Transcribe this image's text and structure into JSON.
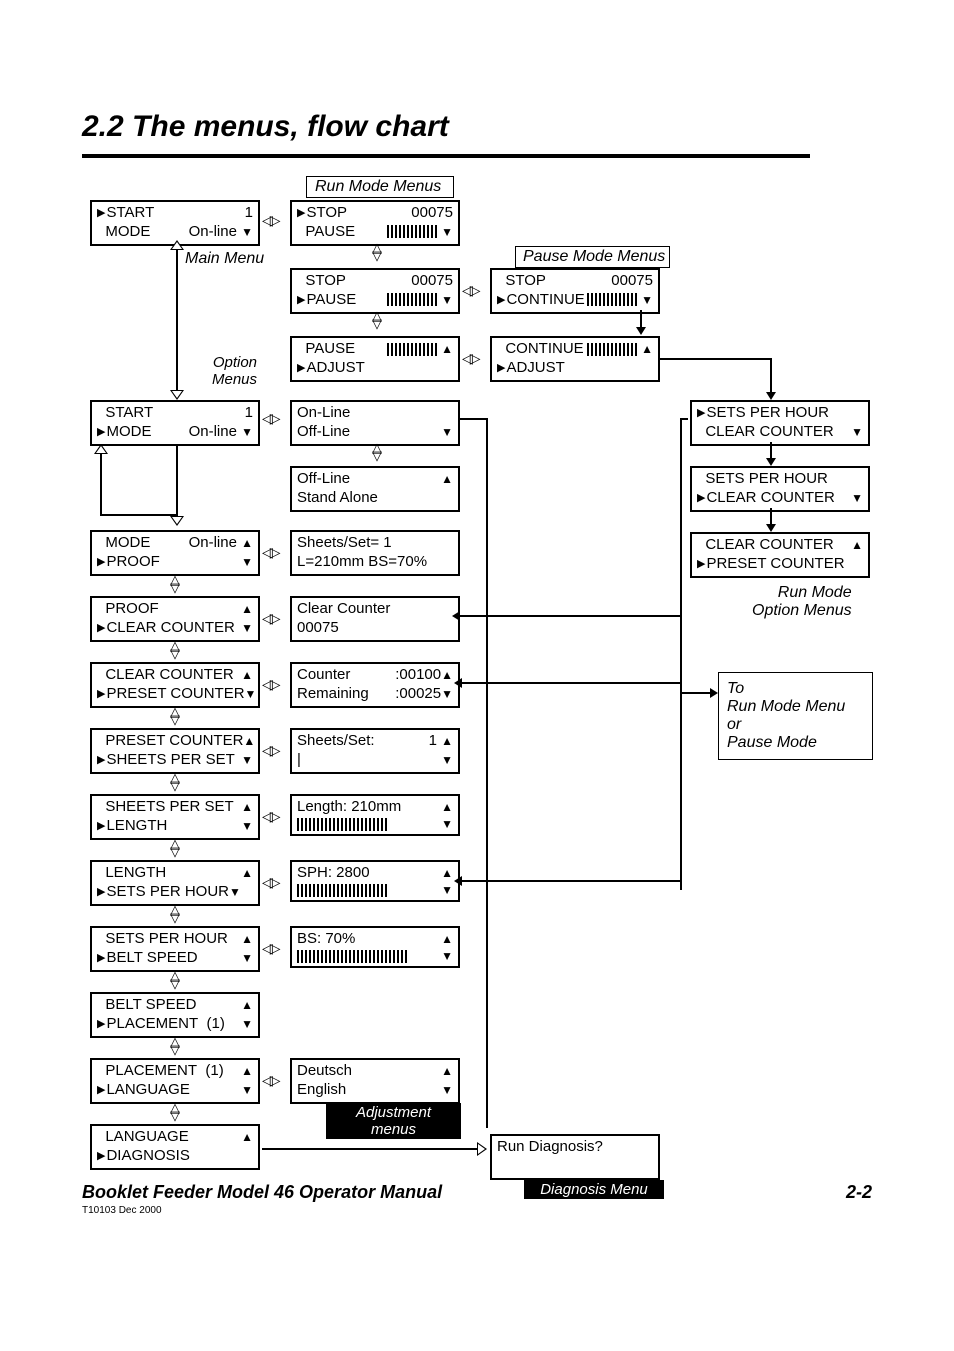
{
  "title": "2.2 The menus, flow chart",
  "labels": {
    "run_mode_menus": "Run Mode Menus",
    "main_menu": "Main Menu",
    "pause_mode_menus": "Pause Mode Menus",
    "option_menus_l1": "Option",
    "option_menus_l2": "Menus",
    "run_mode_l1": "Run Mode",
    "run_mode_l2": "Option Menus",
    "to_l1": "To",
    "to_l2": "Run Mode Menu",
    "to_l3": "or",
    "to_l4": "Pause Mode",
    "adjustment_menus": "Adjustment menus",
    "diagnosis_menu": "Diagnosis Menu"
  },
  "col1": {
    "b1": {
      "l1a": "START",
      "l1b": "1",
      "l2a": "MODE",
      "l2b": "On-line"
    },
    "b2": {
      "l1a": "START",
      "l1b": "1",
      "l2a": "MODE",
      "l2b": "On-line"
    },
    "b3": {
      "l1a": "MODE",
      "l1b": "On-line",
      "l2a": "PROOF"
    },
    "b4": {
      "l1a": "PROOF",
      "l2a": "CLEAR COUNTER"
    },
    "b5": {
      "l1a": "CLEAR COUNTER",
      "l2a": "PRESET COUNTER"
    },
    "b6": {
      "l1a": "PRESET COUNTER",
      "l2a": "SHEETS PER SET"
    },
    "b7": {
      "l1a": "SHEETS PER SET",
      "l2a": "LENGTH"
    },
    "b8": {
      "l1a": "LENGTH",
      "l2a": "SETS PER HOUR"
    },
    "b9": {
      "l1a": "SETS PER HOUR",
      "l2a": "BELT SPEED"
    },
    "b10": {
      "l1a": "BELT SPEED",
      "l2a": "PLACEMENT",
      "l2b": "(1)"
    },
    "b11": {
      "l1a": "PLACEMENT",
      "l1b": "(1)",
      "l2a": "LANGUAGE"
    },
    "b12": {
      "l1a": "LANGUAGE",
      "l2a": "DIAGNOSIS"
    }
  },
  "col2": {
    "b1": {
      "l1a": "STOP",
      "l1b": "00075",
      "l2a": "PAUSE"
    },
    "b2": {
      "l1a": "STOP",
      "l1b": "00075",
      "l2a": "PAUSE"
    },
    "b3": {
      "l1a": "PAUSE",
      "l2a": "ADJUST"
    },
    "b4": {
      "l1a": "On-Line",
      "l2a": "Off-Line"
    },
    "b5": {
      "l1a": "Off-Line",
      "l2a": "Stand Alone"
    },
    "b6": {
      "l1a": "Sheets/Set= 1",
      "l2a": "L=210mm  BS=70%"
    },
    "b7": {
      "l1a": "Clear Counter",
      "l2a": "00075"
    },
    "b8": {
      "l1a": "Counter",
      "l1b": ":00100",
      "l2a": "Remaining",
      "l2b": ":00025"
    },
    "b9": {
      "l1a": "Sheets/Set:",
      "l1b": "1",
      "l2a": "|"
    },
    "b10": {
      "l1a": "Length: 210mm"
    },
    "b11": {
      "l1a": "SPH: 2800"
    },
    "b12": {
      "l1a": "BS: 70%"
    },
    "b13": {
      "l1a": "Deutsch",
      "l2a": "English"
    }
  },
  "col3": {
    "b1": {
      "l1a": "STOP",
      "l1b": "00075",
      "l2a": "CONTINUE"
    },
    "b2": {
      "l1a": "CONTINUE",
      "l2a": "ADJUST"
    }
  },
  "col4": {
    "b1": {
      "l1a": "SETS PER HOUR",
      "l2a": "CLEAR COUNTER"
    },
    "b2": {
      "l1a": "SETS PER HOUR",
      "l2a": "CLEAR COUNTER"
    },
    "b3": {
      "l1a": "CLEAR COUNTER",
      "l2a": "PRESET COUNTER"
    }
  },
  "diag": {
    "q": "Run Diagnosis?"
  },
  "footer": {
    "title": "Booklet Feeder Model 46 Operator Manual",
    "page": "2-2",
    "rev": "T10103    Dec 2000"
  }
}
